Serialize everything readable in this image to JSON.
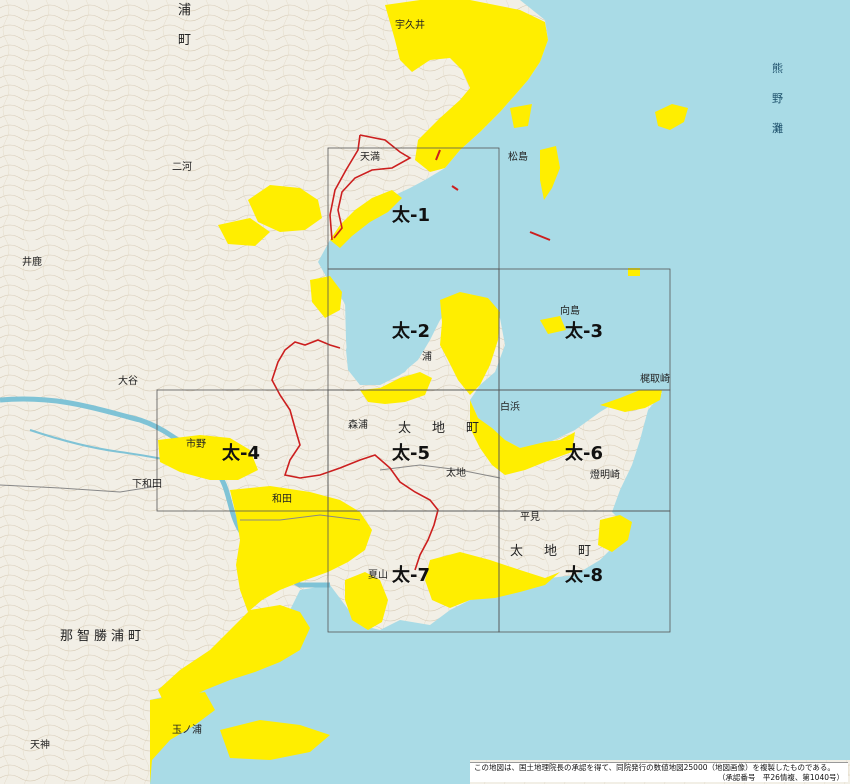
{
  "map": {
    "colors": {
      "sea": "#a9dbe6",
      "land": "#f2efe6",
      "contour": "#cdbfa7",
      "highlight": "#ffee00",
      "boundary": "#cc1f1f",
      "grid": "#555555",
      "river": "#7fc3d6"
    },
    "grid_cells": [
      {
        "id": "cell-1",
        "label": "太-1"
      },
      {
        "id": "cell-2",
        "label": "太-2"
      },
      {
        "id": "cell-3",
        "label": "太-3"
      },
      {
        "id": "cell-4",
        "label": "太-4"
      },
      {
        "id": "cell-5",
        "label": "太-5"
      },
      {
        "id": "cell-6",
        "label": "太-6"
      },
      {
        "id": "cell-7",
        "label": "太-7"
      },
      {
        "id": "cell-8",
        "label": "太-8"
      }
    ],
    "places": {
      "ura_1": "浦",
      "machi_1": "町",
      "kumano_1": "熊",
      "kumano_2": "野",
      "kumano_3": "灘",
      "taiji_town": "太　地　町",
      "taiji_town_2": "太　地　町",
      "nachi": "那智勝浦町",
      "moriura": "森浦",
      "ichino": "市野",
      "shimowada": "下和田",
      "taiji": "太地",
      "tamanoura": "玉ノ浦",
      "wadanoura": "和田",
      "yuminosato": "夏山",
      "kozagawa": "二河",
      "ura": "浦",
      "tenma": "天満",
      "ichinonose": "平見",
      "shiranami": "白浜",
      "kanda": "燈明崎",
      "ryoubou": "梶取崎",
      "toyomi": "向島",
      "matsushima": "松島",
      "tokutake": "大谷",
      "ooyama": "宇久井",
      "mikawa": "井鹿",
      "hinokami": "天神"
    },
    "credit": {
      "line1": "この地図は、国土地理院長の承認を得て、同院発行の数値地図25000（地図画像）を複製したものである。",
      "line2": "（承認番号　平26情複、第1040号）"
    }
  }
}
